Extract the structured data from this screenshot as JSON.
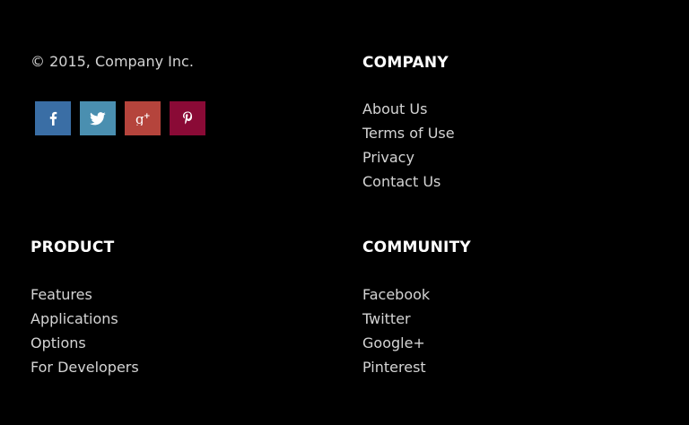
{
  "footer": {
    "copyright": "© 2015, Company Inc.",
    "social": [
      {
        "name": "facebook",
        "icon": "facebook-icon",
        "color": "#3a6ea5"
      },
      {
        "name": "twitter",
        "icon": "twitter-icon",
        "color": "#4a8fb0"
      },
      {
        "name": "google-plus",
        "icon": "google-plus-icon",
        "color": "#b5443c"
      },
      {
        "name": "pinterest",
        "icon": "pinterest-icon",
        "color": "#8a0a36"
      }
    ],
    "company": {
      "heading": "COMPANY",
      "links": [
        "About Us",
        "Terms of Use",
        "Privacy",
        "Contact Us"
      ]
    },
    "product": {
      "heading": "PRODUCT",
      "links": [
        "Features",
        "Applications",
        "Options",
        "For Developers"
      ]
    },
    "community": {
      "heading": "COMMUNITY",
      "links": [
        "Facebook",
        "Twitter",
        "Google+",
        "Pinterest"
      ]
    }
  }
}
